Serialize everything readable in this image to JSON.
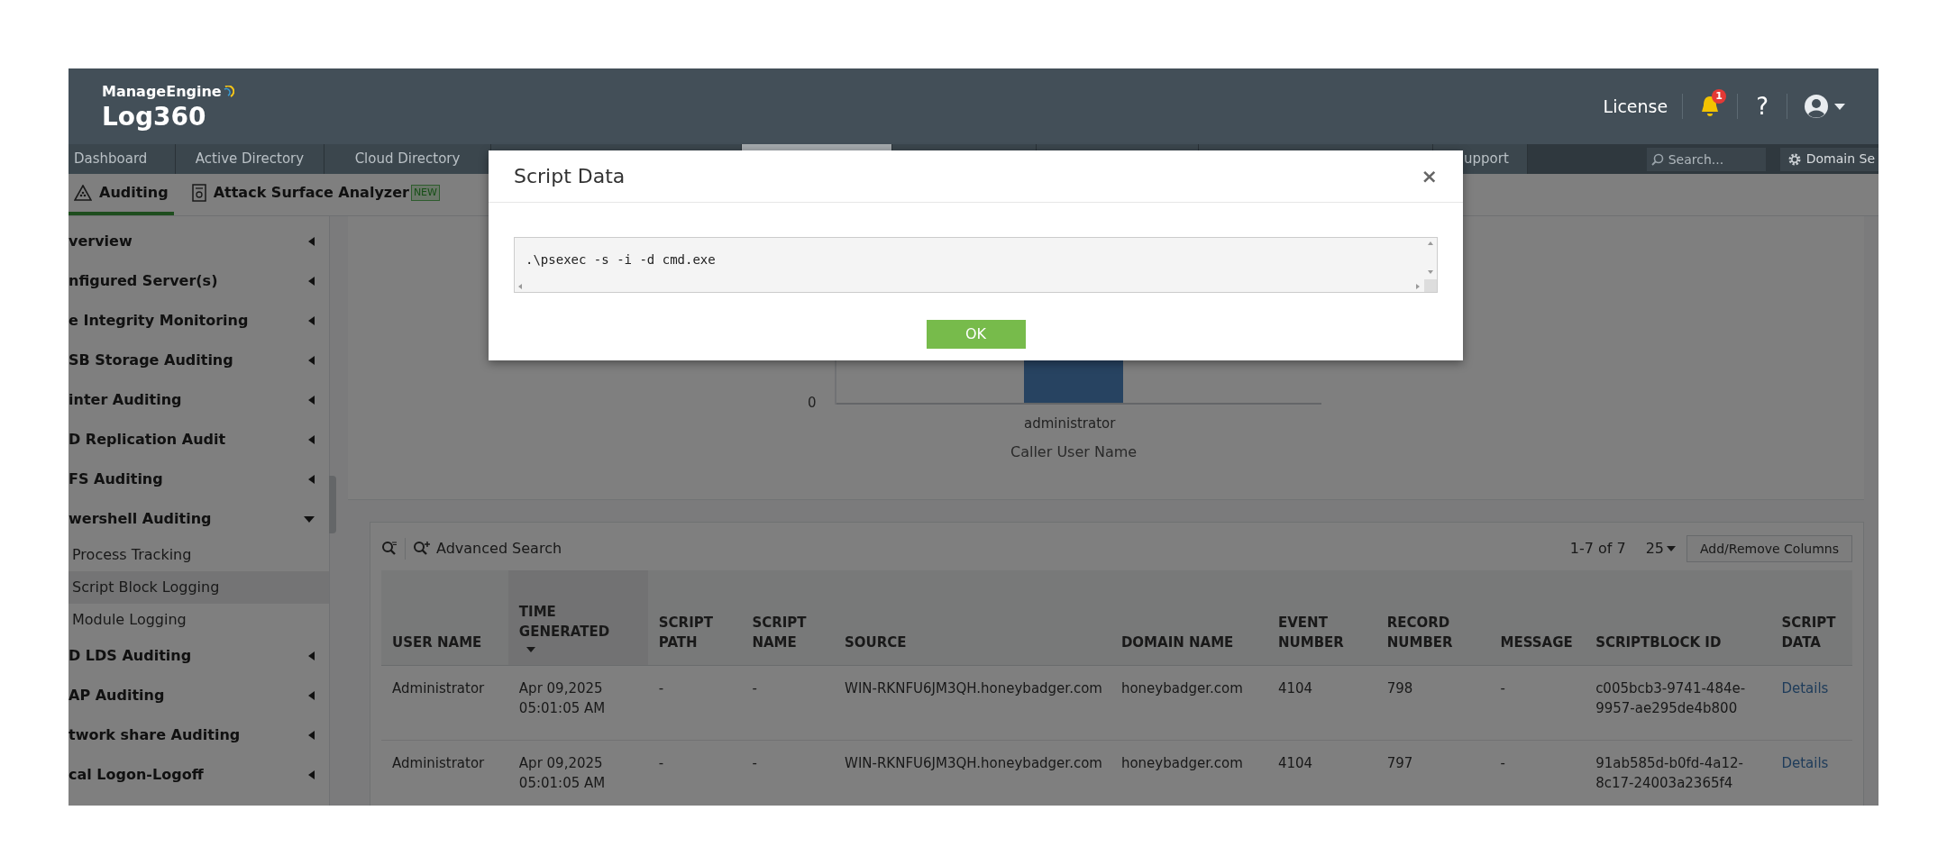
{
  "header": {
    "brand": "ManageEngine",
    "product": "Log360",
    "license": "License",
    "notification_count": "1",
    "help": "?"
  },
  "nav_tabs": [
    {
      "label": "Dashboard",
      "selected": false
    },
    {
      "label": "Active Directory",
      "selected": false
    },
    {
      "label": "Cloud Directory",
      "selected": false
    },
    {
      "selected": false
    },
    {
      "selected": true
    },
    {
      "selected": false
    },
    {
      "selected": false
    },
    {
      "selected": false
    },
    {
      "label": "upport",
      "selected": false
    }
  ],
  "search": {
    "placeholder": "Search..."
  },
  "domain_settings": "Domain Se",
  "sub_tabs": [
    {
      "label": "Auditing",
      "selected": true
    },
    {
      "label": "Attack Surface Analyzer",
      "badge": "NEW",
      "selected": false
    }
  ],
  "sidebar": {
    "items": [
      {
        "label": "verview",
        "expanded": false
      },
      {
        "label": "nfigured Server(s)",
        "expanded": false
      },
      {
        "label": "e Integrity Monitoring",
        "expanded": false
      },
      {
        "label": "SB Storage Auditing",
        "expanded": false
      },
      {
        "label": "inter Auditing",
        "expanded": false
      },
      {
        "label": "D Replication Audit",
        "expanded": false
      },
      {
        "label": "FS Auditing",
        "expanded": false
      },
      {
        "label": "wershell Auditing",
        "expanded": true,
        "children": [
          {
            "label": "Process Tracking",
            "selected": false
          },
          {
            "label": "Script Block Logging",
            "selected": true
          },
          {
            "label": "Module Logging",
            "selected": false
          }
        ]
      },
      {
        "label": "D LDS Auditing",
        "expanded": false
      },
      {
        "label": "AP Auditing",
        "expanded": false
      },
      {
        "label": "twork share Auditing",
        "expanded": false
      },
      {
        "label": "cal Logon-Logoff",
        "expanded": false
      }
    ]
  },
  "chart": {
    "y_tick": "0",
    "category": "administrator",
    "xlabel": "Caller User Name"
  },
  "table": {
    "toolbar": {
      "advanced_search": "Advanced Search",
      "range": "1-7 of 7",
      "page_size": "25",
      "columns_button": "Add/Remove Columns"
    },
    "columns": [
      {
        "label": "USER NAME",
        "sorted": false
      },
      {
        "label": "TIME GENERATED",
        "sorted": true
      },
      {
        "label": "SCRIPT PATH",
        "sorted": false
      },
      {
        "label": "SCRIPT NAME",
        "sorted": false
      },
      {
        "label": "SOURCE",
        "sorted": false
      },
      {
        "label": "DOMAIN NAME",
        "sorted": false
      },
      {
        "label": "EVENT NUMBER",
        "sorted": false
      },
      {
        "label": "RECORD NUMBER",
        "sorted": false
      },
      {
        "label": "MESSAGE",
        "sorted": false
      },
      {
        "label": "SCRIPTBLOCK ID",
        "sorted": false
      },
      {
        "label": "SCRIPT DATA",
        "sorted": false
      }
    ],
    "rows": [
      [
        "Administrator",
        "Apr 09,2025 05:01:05 AM",
        "-",
        "-",
        "WIN-RKNFU6JM3QH.honeybadger.com",
        "honeybadger.com",
        "4104",
        "798",
        "-",
        "c005bcb3-9741-484e-9957-ae295de4b800",
        "Details"
      ],
      [
        "Administrator",
        "Apr 09,2025 05:01:05 AM",
        "-",
        "-",
        "WIN-RKNFU6JM3QH.honeybadger.com",
        "honeybadger.com",
        "4104",
        "797",
        "-",
        "91ab585d-b0fd-4a12-8c17-24003a2365f4",
        "Details"
      ]
    ]
  },
  "modal": {
    "title": "Script Data",
    "close": "×",
    "script": ".\\psexec -s -i -d cmd.exe",
    "ok": "OK"
  }
}
